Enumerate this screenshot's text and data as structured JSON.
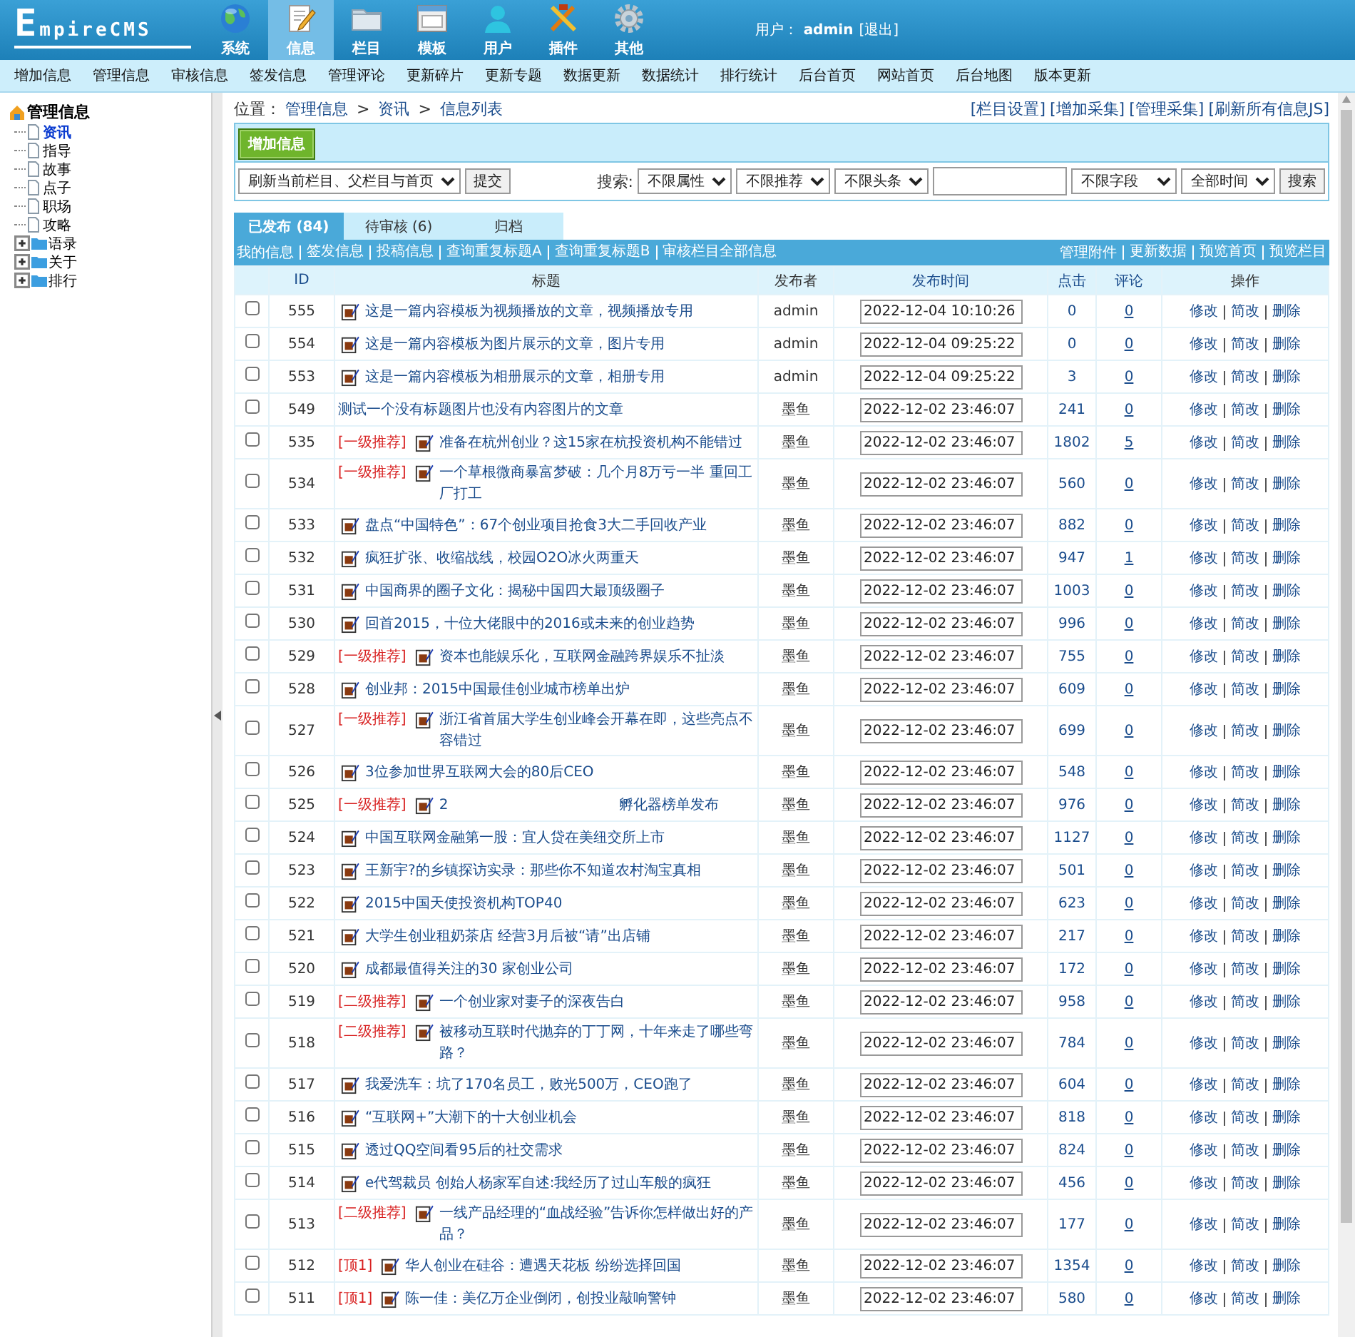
{
  "header": {
    "logo": "EmpireCMS",
    "nav": [
      {
        "label": "系统",
        "selected": false
      },
      {
        "label": "信息",
        "selected": true
      },
      {
        "label": "栏目",
        "selected": false
      },
      {
        "label": "模板",
        "selected": false
      },
      {
        "label": "用户",
        "selected": false
      },
      {
        "label": "插件",
        "selected": false
      },
      {
        "label": "其他",
        "selected": false
      }
    ],
    "user_label": "用户：",
    "user": "admin",
    "logout": "[退出]"
  },
  "menu": [
    "增加信息",
    "管理信息",
    "审核信息",
    "签发信息",
    "管理评论",
    "更新碎片",
    "更新专题",
    "数据更新",
    "数据统计",
    "排行统计",
    "后台首页",
    "网站首页",
    "后台地图",
    "版本更新"
  ],
  "sidebar": {
    "root": "管理信息",
    "items": [
      {
        "label": "资讯",
        "kind": "page",
        "selected": true
      },
      {
        "label": "指导",
        "kind": "page",
        "selected": false
      },
      {
        "label": "故事",
        "kind": "page",
        "selected": false
      },
      {
        "label": "点子",
        "kind": "page",
        "selected": false
      },
      {
        "label": "职场",
        "kind": "page",
        "selected": false
      },
      {
        "label": "攻略",
        "kind": "page",
        "selected": false
      },
      {
        "label": "语录",
        "kind": "folder",
        "selected": false
      },
      {
        "label": "关于",
        "kind": "folder",
        "selected": false
      },
      {
        "label": "排行",
        "kind": "folder",
        "selected": false
      }
    ]
  },
  "breadcrumb": {
    "label": "位置：",
    "links": [
      "管理信息",
      "资讯",
      "信息列表"
    ],
    "separator": ">"
  },
  "top_links": [
    "[栏目设置]",
    "[增加采集]",
    "[管理采集]",
    "[刷新所有信息JS]"
  ],
  "toolbar": {
    "add_button": "增加信息",
    "refresh_select": "刷新当前栏目、父栏目与首页",
    "submit_button": "提交",
    "search_label": "搜索:",
    "filters": [
      "不限属性",
      "不限推荐",
      "不限头条"
    ],
    "field_select": "不限字段",
    "time_select": "全部时间",
    "search_button": "搜索"
  },
  "tabs": [
    {
      "label": "已发布 (84)",
      "selected": true
    },
    {
      "label": "待审核 (6)",
      "selected": false
    },
    {
      "label": "归档",
      "selected": false
    }
  ],
  "left_links": [
    "我的信息",
    "签发信息",
    "投稿信息",
    "查询重复标题A",
    "查询重复标题B",
    "审核栏目全部信息"
  ],
  "right_links": [
    "管理附件",
    "更新数据",
    "预览首页",
    "预览栏目"
  ],
  "table": {
    "columns": [
      {
        "label": "ID",
        "sortable": true
      },
      {
        "label": "标题",
        "sortable": false
      },
      {
        "label": "发布者",
        "sortable": false
      },
      {
        "label": "发布时间",
        "sortable": true
      },
      {
        "label": "点击",
        "sortable": true
      },
      {
        "label": "评论",
        "sortable": true
      },
      {
        "label": "操作",
        "sortable": false
      }
    ],
    "rows": [
      {
        "checked": false,
        "id": "555",
        "has_icon": true,
        "title": "这是一篇内容模板为视频播放的文章，视频播放专用",
        "author": "admin",
        "time": "2022-12-04 10:10:26",
        "clicks": "0",
        "comments": "0",
        "actions": [
          "修改",
          "简改",
          "删除"
        ]
      },
      {
        "checked": false,
        "id": "554",
        "has_icon": true,
        "title": "这是一篇内容模板为图片展示的文章，图片专用",
        "author": "admin",
        "time": "2022-12-04 09:25:22",
        "clicks": "0",
        "comments": "0",
        "actions": [
          "修改",
          "简改",
          "删除"
        ]
      },
      {
        "checked": false,
        "id": "553",
        "has_icon": true,
        "title": "这是一篇内容模板为相册展示的文章，相册专用",
        "author": "admin",
        "time": "2022-12-04 09:25:22",
        "clicks": "3",
        "comments": "0",
        "actions": [
          "修改",
          "简改",
          "删除"
        ]
      },
      {
        "checked": false,
        "id": "549",
        "has_icon": false,
        "title": "测试一个没有标题图片也没有内容图片的文章",
        "author": "墨鱼",
        "time": "2022-12-02 23:46:07",
        "clicks": "241",
        "comments": "0",
        "actions": [
          "修改",
          "简改",
          "删除"
        ]
      },
      {
        "checked": false,
        "id": "535",
        "tag": "[一级推荐]",
        "has_icon": true,
        "title": "准备在杭州创业？这15家在杭投资机构不能错过",
        "author": "墨鱼",
        "time": "2022-12-02 23:46:07",
        "clicks": "1802",
        "comments": "5",
        "actions": [
          "修改",
          "简改",
          "删除"
        ]
      },
      {
        "checked": false,
        "id": "534",
        "tag": "[一级推荐]",
        "has_icon": true,
        "title": "一个草根微商暴富梦破：几个月8万亏一半 重回工厂打工",
        "author": "墨鱼",
        "time": "2022-12-02 23:46:07",
        "clicks": "560",
        "comments": "0",
        "actions": [
          "修改",
          "简改",
          "删除"
        ]
      },
      {
        "checked": false,
        "id": "533",
        "has_icon": true,
        "title": "盘点“中国特色”：67个创业项目抢食3大二手回收产业",
        "author": "墨鱼",
        "time": "2022-12-02 23:46:07",
        "clicks": "882",
        "comments": "0",
        "actions": [
          "修改",
          "简改",
          "删除"
        ]
      },
      {
        "checked": false,
        "id": "532",
        "has_icon": true,
        "title": "疯狂扩张、收缩战线，校园O2O冰火两重天",
        "author": "墨鱼",
        "time": "2022-12-02 23:46:07",
        "clicks": "947",
        "comments": "1",
        "actions": [
          "修改",
          "简改",
          "删除"
        ]
      },
      {
        "checked": false,
        "id": "531",
        "has_icon": true,
        "title": "中国商界的圈子文化：揭秘中国四大最顶级圈子",
        "author": "墨鱼",
        "time": "2022-12-02 23:46:07",
        "clicks": "1003",
        "comments": "0",
        "actions": [
          "修改",
          "简改",
          "删除"
        ]
      },
      {
        "checked": false,
        "id": "530",
        "has_icon": true,
        "title": "回首2015，十位大佬眼中的2016或未来的创业趋势",
        "author": "墨鱼",
        "time": "2022-12-02 23:46:07",
        "clicks": "996",
        "comments": "0",
        "actions": [
          "修改",
          "简改",
          "删除"
        ]
      },
      {
        "checked": false,
        "id": "529",
        "tag": "[一级推荐]",
        "has_icon": true,
        "title": "资本也能娱乐化，互联网金融跨界娱乐不扯淡",
        "author": "墨鱼",
        "time": "2022-12-02 23:46:07",
        "clicks": "755",
        "comments": "0",
        "actions": [
          "修改",
          "简改",
          "删除"
        ]
      },
      {
        "checked": false,
        "id": "528",
        "has_icon": true,
        "title": "创业邦：2015中国最佳创业城市榜单出炉",
        "author": "墨鱼",
        "time": "2022-12-02 23:46:07",
        "clicks": "609",
        "comments": "0",
        "actions": [
          "修改",
          "简改",
          "删除"
        ]
      },
      {
        "checked": false,
        "id": "527",
        "tag": "[一级推荐]",
        "has_icon": true,
        "title": "浙江省首届大学生创业峰会开幕在即，这些亮点不容错过",
        "author": "墨鱼",
        "time": "2022-12-02 23:46:07",
        "clicks": "699",
        "comments": "0",
        "actions": [
          "修改",
          "简改",
          "删除"
        ]
      },
      {
        "checked": false,
        "id": "526",
        "has_icon": true,
        "title": "3位参加世界互联网大会的80后CEO",
        "author": "墨鱼",
        "time": "2022-12-02 23:46:07",
        "clicks": "548",
        "comments": "0",
        "actions": [
          "修改",
          "简改",
          "删除"
        ]
      },
      {
        "checked": false,
        "id": "525",
        "tag": "[一级推荐]",
        "has_icon": true,
        "title": "2",
        "title_end": "孵化器榜单发布",
        "author": "墨鱼",
        "time": "2022-12-02 23:46:07",
        "clicks": "976",
        "comments": "0",
        "actions": [
          "修改",
          "简改",
          "删除"
        ]
      },
      {
        "checked": false,
        "id": "524",
        "has_icon": true,
        "title": "中国互联网金融第一股：宜人贷在美纽交所上市",
        "author": "墨鱼",
        "time": "2022-12-02 23:46:07",
        "clicks": "1127",
        "comments": "0",
        "actions": [
          "修改",
          "简改",
          "删除"
        ]
      },
      {
        "checked": false,
        "id": "523",
        "has_icon": true,
        "title": "王新宇?的乡镇探访实录：那些你不知道农村淘宝真相",
        "author": "墨鱼",
        "time": "2022-12-02 23:46:07",
        "clicks": "501",
        "comments": "0",
        "actions": [
          "修改",
          "简改",
          "删除"
        ]
      },
      {
        "checked": false,
        "id": "522",
        "has_icon": true,
        "title": "2015中国天使投资机构TOP40",
        "author": "墨鱼",
        "time": "2022-12-02 23:46:07",
        "clicks": "623",
        "comments": "0",
        "actions": [
          "修改",
          "简改",
          "删除"
        ]
      },
      {
        "checked": false,
        "id": "521",
        "has_icon": true,
        "title": "大学生创业租奶茶店 经营3月后被“请”出店铺",
        "author": "墨鱼",
        "time": "2022-12-02 23:46:07",
        "clicks": "217",
        "comments": "0",
        "actions": [
          "修改",
          "简改",
          "删除"
        ]
      },
      {
        "checked": false,
        "id": "520",
        "has_icon": true,
        "title": "成都最值得关注的30 家创业公司",
        "author": "墨鱼",
        "time": "2022-12-02 23:46:07",
        "clicks": "172",
        "comments": "0",
        "actions": [
          "修改",
          "简改",
          "删除"
        ]
      },
      {
        "checked": false,
        "id": "519",
        "tag": "[二级推荐]",
        "has_icon": true,
        "title": "一个创业家对妻子的深夜告白",
        "author": "墨鱼",
        "time": "2022-12-02 23:46:07",
        "clicks": "958",
        "comments": "0",
        "actions": [
          "修改",
          "简改",
          "删除"
        ]
      },
      {
        "checked": false,
        "id": "518",
        "tag": "[二级推荐]",
        "has_icon": true,
        "title": "被移动互联时代抛弃的丁丁网，十年来走了哪些弯路？",
        "author": "墨鱼",
        "time": "2022-12-02 23:46:07",
        "clicks": "784",
        "comments": "0",
        "actions": [
          "修改",
          "简改",
          "删除"
        ]
      },
      {
        "checked": false,
        "id": "517",
        "has_icon": true,
        "title": "我爱洗车：坑了170名员工，败光500万，CEO跑了",
        "author": "墨鱼",
        "time": "2022-12-02 23:46:07",
        "clicks": "604",
        "comments": "0",
        "actions": [
          "修改",
          "简改",
          "删除"
        ]
      },
      {
        "checked": false,
        "id": "516",
        "has_icon": true,
        "title": "“互联网+”大潮下的十大创业机会",
        "author": "墨鱼",
        "time": "2022-12-02 23:46:07",
        "clicks": "818",
        "comments": "0",
        "actions": [
          "修改",
          "简改",
          "删除"
        ]
      },
      {
        "checked": false,
        "id": "515",
        "has_icon": true,
        "title": "透过QQ空间看95后的社交需求",
        "author": "墨鱼",
        "time": "2022-12-02 23:46:07",
        "clicks": "824",
        "comments": "0",
        "actions": [
          "修改",
          "简改",
          "删除"
        ]
      },
      {
        "checked": false,
        "id": "514",
        "has_icon": true,
        "title": "e代驾裁员 创始人杨家军自述:我经历了过山车般的疯狂",
        "author": "墨鱼",
        "time": "2022-12-02 23:46:07",
        "clicks": "456",
        "comments": "0",
        "actions": [
          "修改",
          "简改",
          "删除"
        ]
      },
      {
        "checked": false,
        "id": "513",
        "tag": "[二级推荐]",
        "has_icon": true,
        "title": "一线产品经理的“血战经验”告诉你怎样做出好的产品？",
        "author": "墨鱼",
        "time": "2022-12-02 23:46:07",
        "clicks": "177",
        "comments": "0",
        "actions": [
          "修改",
          "简改",
          "删除"
        ]
      },
      {
        "checked": false,
        "id": "512",
        "tag": "[顶1]",
        "has_icon": true,
        "title": "华人创业在硅谷：遭遇天花板 纷纷选择回国",
        "author": "墨鱼",
        "time": "2022-12-02 23:46:07",
        "clicks": "1354",
        "comments": "0",
        "actions": [
          "修改",
          "简改",
          "删除"
        ]
      },
      {
        "checked": false,
        "id": "511",
        "tag": "[顶1]",
        "has_icon": true,
        "title": "陈一佳：美亿万企业倒闭，创投业敲响警钟",
        "author": "墨鱼",
        "time": "2022-12-02 23:46:07",
        "clicks": "580",
        "comments": "0",
        "actions": [
          "修改",
          "简改",
          "删除"
        ]
      }
    ]
  }
}
